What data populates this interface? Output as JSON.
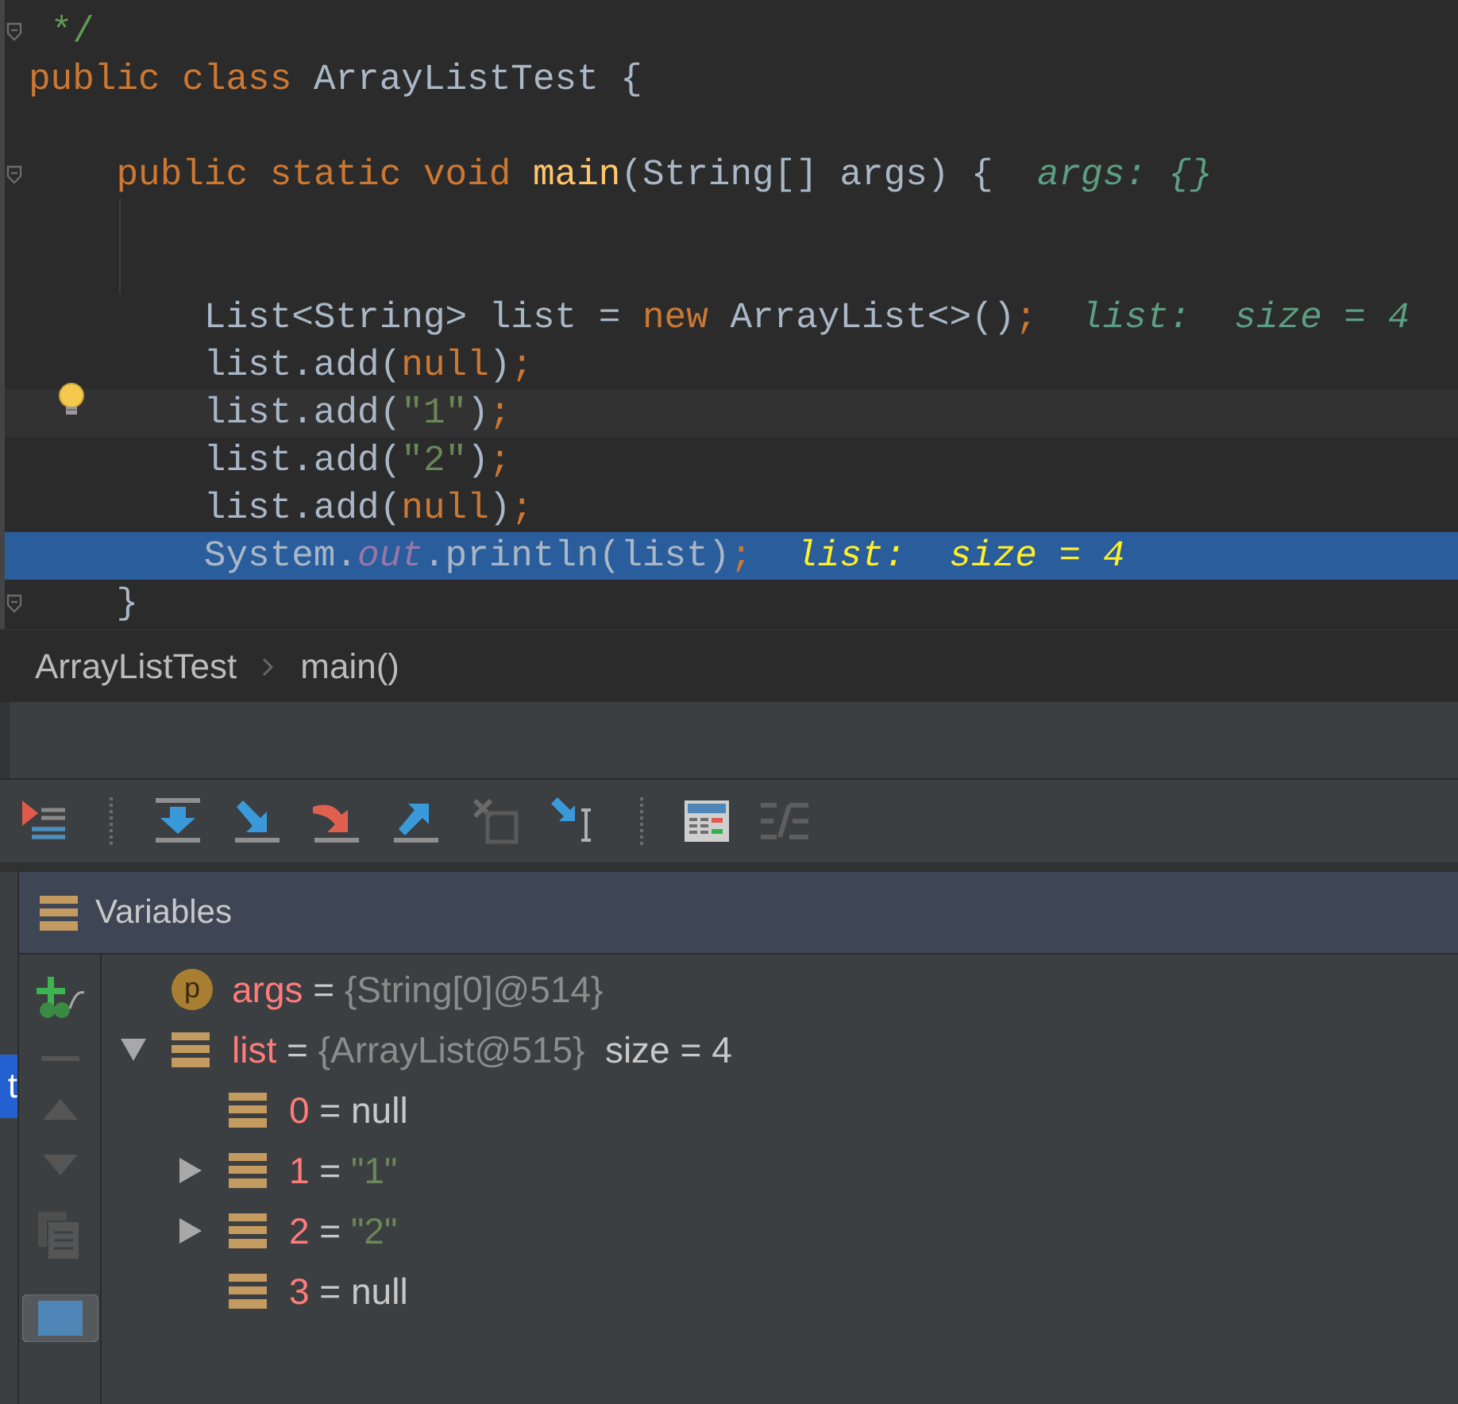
{
  "editor": {
    "lines": [
      {
        "fold": true,
        "caret": false,
        "current": false,
        "tokens": [
          {
            "kind": "comment",
            "text": " */"
          }
        ]
      },
      {
        "fold": false,
        "caret": false,
        "current": false,
        "tokens": [
          {
            "kind": "keyword",
            "text": "public class "
          },
          {
            "kind": "plain",
            "text": "ArrayListTest {"
          }
        ]
      },
      {
        "kind": "blank"
      },
      {
        "fold": true,
        "caret": false,
        "current": false,
        "tokens": [
          {
            "kind": "keyword",
            "text": "    public static void "
          },
          {
            "kind": "method",
            "text": "main"
          },
          {
            "kind": "plain",
            "text": "(String[] args) {  "
          },
          {
            "kind": "hint",
            "text": "args: {}"
          }
        ]
      },
      {
        "kind": "blank"
      },
      {
        "kind": "blank"
      },
      {
        "fold": false,
        "caret": false,
        "current": false,
        "tokens": [
          {
            "kind": "plain",
            "text": "        List<String> list = "
          },
          {
            "kind": "keyword",
            "text": "new "
          },
          {
            "kind": "plain",
            "text": "ArrayList<>()"
          },
          {
            "kind": "keyword",
            "text": ";  "
          },
          {
            "kind": "hint",
            "text": "list:  size = 4"
          }
        ]
      },
      {
        "fold": false,
        "caret": false,
        "current": false,
        "tokens": [
          {
            "kind": "plain",
            "text": "        list.add("
          },
          {
            "kind": "keyword",
            "text": "null"
          },
          {
            "kind": "plain",
            "text": ")"
          },
          {
            "kind": "keyword",
            "text": ";"
          }
        ]
      },
      {
        "fold": false,
        "caret": true,
        "current": false,
        "tokens": [
          {
            "kind": "plain",
            "text": "        list.add("
          },
          {
            "kind": "string",
            "text": "\"1\""
          },
          {
            "kind": "plain",
            "text": ")"
          },
          {
            "kind": "keyword",
            "text": ";"
          }
        ]
      },
      {
        "fold": false,
        "caret": false,
        "current": false,
        "tokens": [
          {
            "kind": "plain",
            "text": "        list.add("
          },
          {
            "kind": "string",
            "text": "\"2\""
          },
          {
            "kind": "plain",
            "text": ")"
          },
          {
            "kind": "keyword",
            "text": ";"
          }
        ]
      },
      {
        "fold": false,
        "caret": false,
        "current": false,
        "tokens": [
          {
            "kind": "plain",
            "text": "        list.add("
          },
          {
            "kind": "keyword",
            "text": "null"
          },
          {
            "kind": "plain",
            "text": ")"
          },
          {
            "kind": "keyword",
            "text": ";"
          }
        ]
      },
      {
        "fold": false,
        "caret": false,
        "current": true,
        "tokens": [
          {
            "kind": "plain",
            "text": "        System."
          },
          {
            "kind": "field",
            "text": "out"
          },
          {
            "kind": "plain",
            "text": ".println(list)"
          },
          {
            "kind": "keyword",
            "text": ";  "
          },
          {
            "kind": "hint",
            "text": "list:  size = 4"
          }
        ]
      },
      {
        "fold": true,
        "caret": false,
        "current": false,
        "tokens": [
          {
            "kind": "plain",
            "text": "    }"
          }
        ]
      }
    ]
  },
  "breadcrumbs": [
    "ArrayListTest",
    "main()"
  ],
  "side_tab": "t",
  "variables": {
    "title": "Variables",
    "tree": [
      {
        "kind": "param",
        "badge": "p",
        "name": "args",
        "operator": "=",
        "value": "{String[0]@514}",
        "color": "#8c8c8c"
      },
      {
        "kind": "field",
        "name": "list",
        "operator": "=",
        "value": "{ArrayList@515}",
        "color": "#8c8c8c",
        "extra": "size = 4",
        "expanded": true,
        "children": [
          {
            "kind": "field",
            "name": "0",
            "operator": "=",
            "value": "null",
            "color": "#c8c8c8"
          },
          {
            "kind": "field",
            "name": "1",
            "operator": "=",
            "value": "\"1\"",
            "color": "#6a8759",
            "expanded": false
          },
          {
            "kind": "field",
            "name": "2",
            "operator": "=",
            "value": "\"2\"",
            "color": "#6a8759",
            "expanded": false
          },
          {
            "kind": "field",
            "name": "3",
            "operator": "=",
            "value": "null",
            "color": "#c8c8c8"
          }
        ]
      }
    ]
  }
}
